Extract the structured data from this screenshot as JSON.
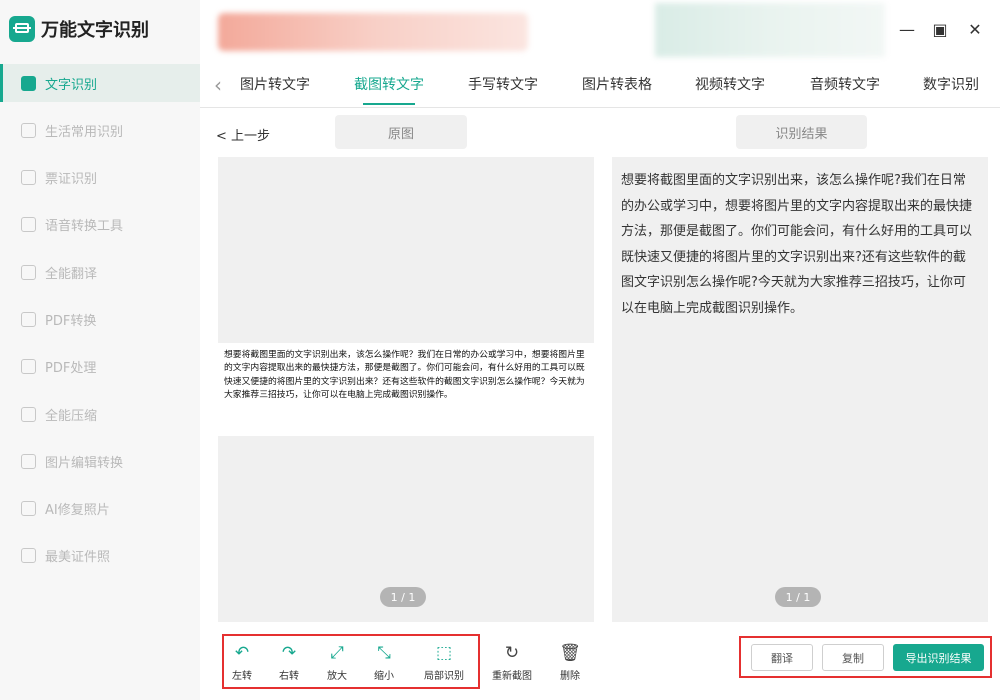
{
  "app": {
    "title": "万能文字识别"
  },
  "sidebar": {
    "items": [
      {
        "label": "文字识别",
        "active": true
      },
      {
        "label": "生活常用识别"
      },
      {
        "label": "票证识别"
      },
      {
        "label": "语音转换工具"
      },
      {
        "label": "全能翻译"
      },
      {
        "label": "PDF转换"
      },
      {
        "label": "PDF处理"
      },
      {
        "label": "全能压缩"
      },
      {
        "label": "图片编辑转换"
      },
      {
        "label": "AI修复照片"
      },
      {
        "label": "最美证件照"
      }
    ]
  },
  "window": {
    "minimize": "—",
    "maximize": "▣",
    "close": "✕"
  },
  "tabs": [
    {
      "label": "图片转文字"
    },
    {
      "label": "截图转文字",
      "active": true
    },
    {
      "label": "手写转文字"
    },
    {
      "label": "图片转表格"
    },
    {
      "label": "视频转文字"
    },
    {
      "label": "音频转文字"
    },
    {
      "label": "数字识别"
    }
  ],
  "main": {
    "back": "< 上一步",
    "original_label": "原图",
    "result_label": "识别结果",
    "original_text": "想要将截图里面的文字识别出来，该怎么操作呢？我们在日常的办公或学习中，想要将图片里的文字内容提取出来的最快捷方法，那便是截图了。你们可能会问，有什么好用的工具可以既快速又便捷的将图片里的文字识别出来？还有这些软件的截图文字识别怎么操作呢？今天就为大家推荐三招技巧，让你可以在电脑上完成截图识别操作。",
    "result_text": "想要将截图里面的文字识别出来，该怎么操作呢?我们在日常的办公或学习中，想要将图片里的文字内容提取出来的最快捷方法，那便是截图了。你们可能会问，有什么好用的工具可以既快速又便捷的将图片里的文字识别出来?还有这些软件的截图文字识别怎么操作呢?今天就为大家推荐三招技巧，让你可以在电脑上完成截图识别操作。",
    "left_pager": "1 / 1",
    "right_pager": "1 / 1"
  },
  "toolbar": {
    "rotate_left": "左转",
    "rotate_right": "右转",
    "zoom_in": "放大",
    "zoom_out": "缩小",
    "partial_ocr": "局部识别",
    "recapture": "重新截图",
    "delete": "删除"
  },
  "actions": {
    "translate": "翻译",
    "copy": "复制",
    "export": "导出识别结果"
  },
  "colors": {
    "accent": "#17a88f",
    "highlight": "#e53030"
  }
}
